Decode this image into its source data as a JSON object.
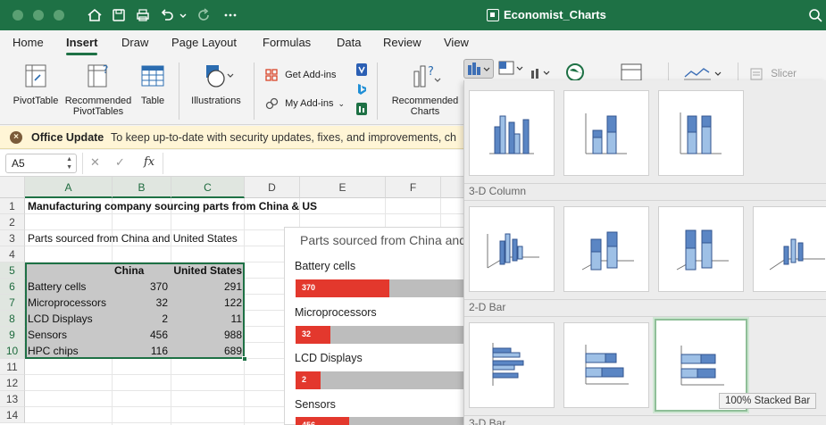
{
  "window": {
    "title": "Economist_Charts"
  },
  "menu": {
    "tabs": [
      "Home",
      "Insert",
      "Draw",
      "Page Layout",
      "Formulas",
      "Data",
      "Review",
      "View"
    ],
    "active": "Insert"
  },
  "ribbon": {
    "pivottable": "PivotTable",
    "recommended_pivot_1": "Recommended",
    "recommended_pivot_2": "PivotTables",
    "table": "Table",
    "illustrations": "Illustrations",
    "get_addins": "Get Add-ins",
    "my_addins": "My Add-ins",
    "recommended_charts_1": "Recommended",
    "recommended_charts_2": "Charts",
    "slicer": "Slicer"
  },
  "update_bar": {
    "title": "Office Update",
    "message": "To keep up-to-date with security updates, fixes, and improvements, ch"
  },
  "formula_bar": {
    "name_box": "A5",
    "fx": "fx",
    "value": ""
  },
  "grid": {
    "columns": [
      "A",
      "B",
      "C",
      "D",
      "E",
      "F"
    ],
    "rows": [
      "1",
      "2",
      "3",
      "4",
      "5",
      "6",
      "7",
      "8",
      "9",
      "10",
      "11",
      "12",
      "13",
      "14"
    ],
    "a1": "Manufacturing company sourcing parts from China & US",
    "a3": "Parts sourced from China and United States",
    "headers": [
      "",
      "China",
      "United States"
    ],
    "data": [
      [
        "Battery cells",
        "370",
        "291"
      ],
      [
        "Microprocessors",
        "32",
        "122"
      ],
      [
        "LCD Displays",
        "2",
        "11"
      ],
      [
        "Sensors",
        "456",
        "988"
      ],
      [
        "HPC chips",
        "116",
        "689"
      ]
    ]
  },
  "chart": {
    "title": "Parts sourced from China and",
    "categories": [
      "Battery cells",
      "Microprocessors",
      "LCD Displays",
      "Sensors"
    ],
    "china_labels": [
      "370",
      "32",
      "2",
      "456"
    ],
    "china_share": [
      0.56,
      0.21,
      0.15,
      0.32
    ],
    "colors": {
      "china": "#e3382d",
      "us": "#bdbdbd"
    }
  },
  "gallery": {
    "section_3d_column": "3-D Column",
    "section_2d_bar": "2-D Bar",
    "section_3d_bar": "3-D Bar",
    "tooltip": "100% Stacked Bar"
  }
}
